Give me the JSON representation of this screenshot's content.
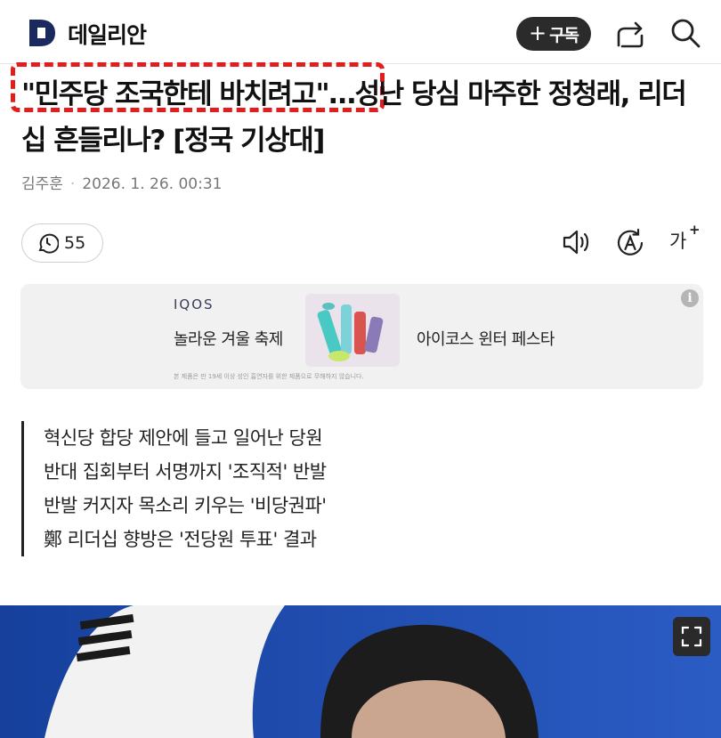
{
  "header": {
    "logo_letter": "D",
    "logo_text": "데일리안",
    "subscribe_plus": "+",
    "subscribe_label": "구독"
  },
  "article": {
    "headline": "\"민주당 조국한테 바치려고\"…성난 당심 마주한 정청래, 리더십 흔들리나? [정국 기상대]",
    "author": "김주훈",
    "separator": "·",
    "date": "2026. 1. 26. 00:31",
    "comment_count": "55",
    "font_size_label": "가",
    "font_size_plus": "+",
    "summary": [
      "혁신당 합당 제안에 들고 일어난 당원",
      "반대 집회부터 서명까지 '조직적' 반발",
      "반발 커지자 목소리 키우는 '비당권파'",
      "鄭 리더십 향방은 '전당원 투표' 결과"
    ]
  },
  "ad": {
    "brand": "IQOS",
    "tagline": "놀라운 겨울 축제",
    "title": "아이코스 윈터 페스타",
    "disclaimer": "본 제품은 만 19세 이상 성인 흡연자를 위한 제품으로 무해하지 않습니다.",
    "info_label": "i"
  },
  "colors": {
    "highlight": "#e11d1d",
    "logo": "#1a2a5e",
    "photo_bg": "#1e48a8"
  },
  "icons": [
    "share-icon",
    "search-icon",
    "clock-comment-icon",
    "speaker-icon",
    "translate-icon",
    "expand-icon"
  ]
}
